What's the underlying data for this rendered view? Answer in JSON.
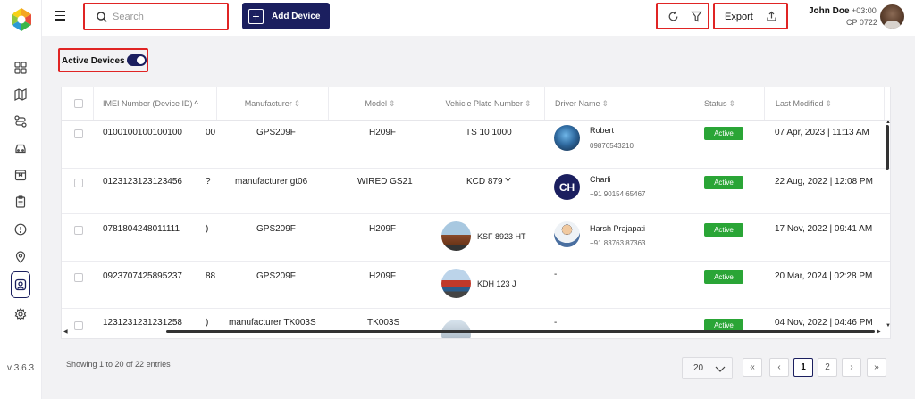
{
  "app": {
    "version": "v 3.6.3"
  },
  "sidebar": {
    "items": [
      {
        "icon": "dashboard-icon"
      },
      {
        "icon": "map-icon"
      },
      {
        "icon": "route-icon"
      },
      {
        "icon": "vehicle-icon"
      },
      {
        "icon": "box-icon"
      },
      {
        "icon": "clipboard-icon"
      },
      {
        "icon": "alert-icon"
      },
      {
        "icon": "location-pin-icon"
      },
      {
        "icon": "device-user-icon",
        "active": true
      },
      {
        "icon": "settings-icon"
      }
    ]
  },
  "header": {
    "search_placeholder": "Search",
    "add_device_label": "Add Device",
    "export_label": "Export",
    "user": {
      "name": "John Doe",
      "timezone": "+03:00",
      "code": "CP 0722"
    }
  },
  "filters": {
    "active_devices_label": "Active Devices",
    "active_devices_on": true
  },
  "table": {
    "columns": [
      "IMEI Number (Device ID)",
      "Manufacturer",
      "Model",
      "Vehicle Plate Number",
      "Driver Name",
      "Status",
      "Last Modified"
    ],
    "rows": [
      {
        "imei": "0100100100100100",
        "clip": "00",
        "manufacturer": "GPS209F",
        "model": "H209F",
        "plate": "TS 10 1000",
        "vehicle_image": false,
        "driver": "Robert",
        "phone": "09876543210",
        "driver_avatar": "photo",
        "status": "Active",
        "modified": "07 Apr, 2023 | 11:13 AM"
      },
      {
        "imei": "0123123123123456",
        "clip": "?",
        "manufacturer": "manufacturer gt06",
        "model": "WIRED GS21",
        "plate": "KCD 879 Y",
        "vehicle_image": false,
        "driver": "Charli",
        "phone": "+91 90154 65467",
        "driver_avatar": "CH",
        "status": "Active",
        "modified": "22 Aug, 2022 | 12:08 PM"
      },
      {
        "imei": "0781804248011111",
        "clip": ")",
        "manufacturer": "GPS209F",
        "model": "H209F",
        "plate": "KSF 8923 HT",
        "vehicle_image": true,
        "driver": "Harsh Prajapati",
        "phone": "+91 83763 87363",
        "driver_avatar": "person",
        "status": "Active",
        "modified": "17 Nov, 2022 | 09:41 AM"
      },
      {
        "imei": "0923707425895237",
        "clip": "88",
        "manufacturer": "GPS209F",
        "model": "H209F",
        "plate": "KDH 123 J",
        "vehicle_image": true,
        "driver": "-",
        "phone": "",
        "driver_avatar": "",
        "status": "Active",
        "modified": "20 Mar, 2024 | 02:28 PM"
      },
      {
        "imei": "1231231231231258",
        "clip": ")",
        "manufacturer": "manufacturer TK003S",
        "model": "TK003S",
        "plate": "",
        "vehicle_image": true,
        "driver": "-",
        "phone": "",
        "driver_avatar": "",
        "status": "Active",
        "modified": "04 Nov, 2022 | 04:46 PM"
      }
    ]
  },
  "pagination": {
    "summary": "Showing 1 to 20 of 22 entries",
    "page_size": "20",
    "pages": [
      "1",
      "2"
    ],
    "current": "1"
  },
  "colors": {
    "brand": "#1b1f5f",
    "status_active": "#2aa536",
    "highlight": "#e02424"
  }
}
